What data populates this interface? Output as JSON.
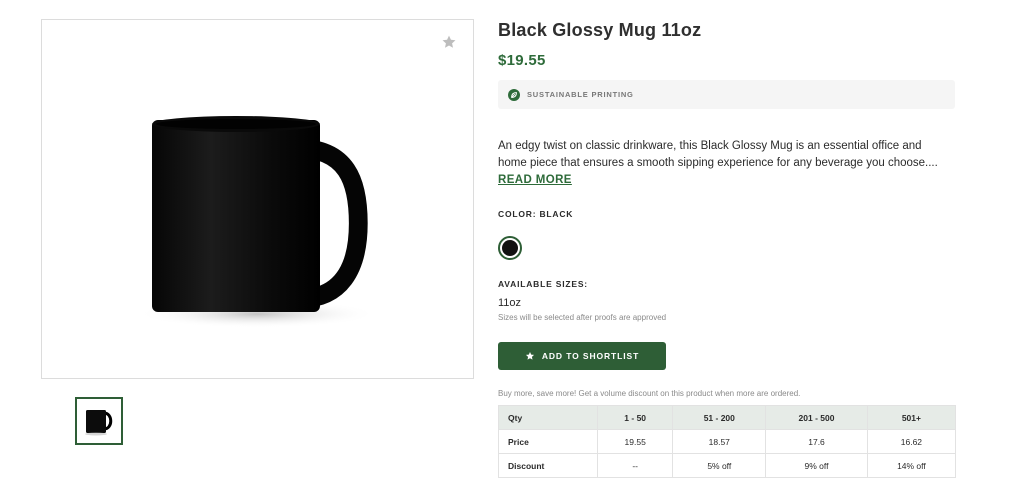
{
  "product": {
    "title": "Black Glossy Mug 11oz",
    "price": "$19.55",
    "badge": "SUSTAINABLE PRINTING",
    "description_line1": "An edgy twist on classic drinkware, this Black Glossy Mug is an essential office and",
    "description_line2": "home piece that ensures a smooth sipping experience for any beverage you choose....",
    "read_more": "READ MORE",
    "color_label": "COLOR: BLACK",
    "swatch_color": "#111111",
    "sizes_label": "AVAILABLE SIZES:",
    "size_value": "11oz",
    "size_note": "Sizes will be selected after proofs are approved",
    "shortlist_button": "ADD TO SHORTLIST",
    "promo_text": "Buy more, save more! Get a volume discount on this product when more are ordered."
  },
  "gallery": {
    "favorite_icon": "star-icon",
    "main_image": "black-mug-image",
    "thumbnail": "black-mug-thumbnail"
  },
  "volume_table": {
    "headers": [
      "Qty",
      "1 - 50",
      "51 - 200",
      "201 - 500",
      "501+"
    ],
    "rows": [
      [
        "Price",
        "19.55",
        "18.57",
        "17.6",
        "16.62"
      ],
      [
        "Discount",
        "--",
        "5% off",
        "9% off",
        "14% off"
      ]
    ]
  },
  "colors": {
    "accent_green": "#2e5e36",
    "price_green": "#2e6b3a",
    "table_header_bg": "#e6ebe7"
  }
}
